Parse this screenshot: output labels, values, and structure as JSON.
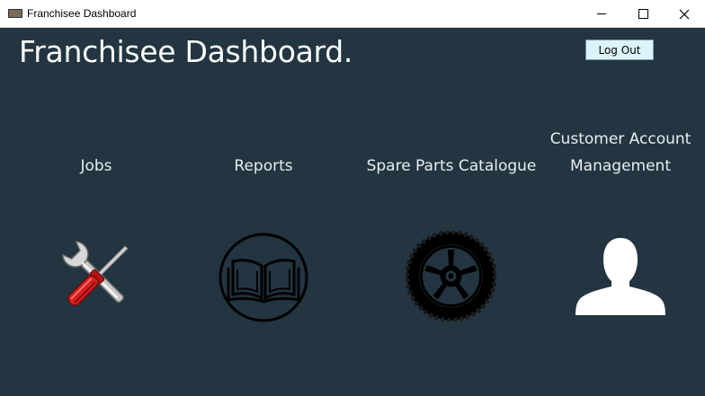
{
  "window": {
    "title": "Franchisee Dashboard",
    "minimize_icon": "minimize-icon",
    "maximize_icon": "maximize-icon",
    "close_icon": "close-icon"
  },
  "header": {
    "title": "Franchisee Dashboard.",
    "logout_label": "Log Out"
  },
  "tiles": [
    {
      "label": "Jobs",
      "icon": "tools-icon"
    },
    {
      "label": "Reports",
      "icon": "book-icon"
    },
    {
      "label": "Spare Parts Catalogue",
      "icon": "tire-icon"
    },
    {
      "label_line1": "Customer Account",
      "label_line2": "Management",
      "icon": "user-icon"
    }
  ],
  "colors": {
    "background": "#223541",
    "text": "#ffffff",
    "logout_bg": "#ddf3fb"
  }
}
